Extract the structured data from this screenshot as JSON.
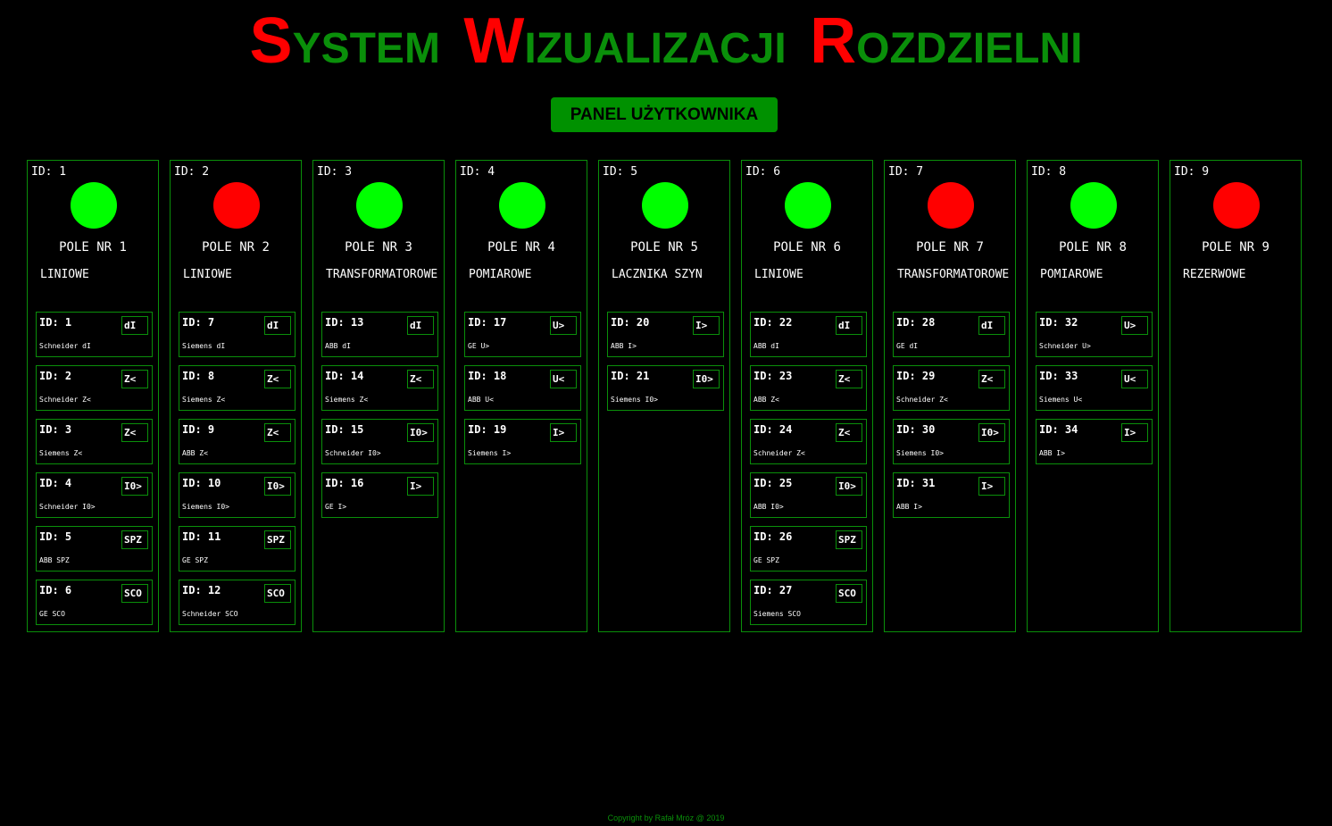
{
  "title": {
    "words": [
      {
        "cap": "S",
        "rest": "YSTEM"
      },
      {
        "cap": "W",
        "rest": "IZUALIZACJI"
      },
      {
        "cap": "R",
        "rest": "OZDZIELNI"
      }
    ]
  },
  "panel_button": "PANEL UŻYTKOWNIKA",
  "colors": {
    "on": "#00ff00",
    "off": "#ff0000",
    "border": "#0a8f0a",
    "button": "#009100"
  },
  "columns": [
    {
      "id_label": "ID: 1",
      "status": "on",
      "name": "POLE NR 1",
      "type": "LINIOWE",
      "devices": [
        {
          "id_label": "ID: 1",
          "code": "dI",
          "desc": "Schneider dI"
        },
        {
          "id_label": "ID: 2",
          "code": "Z<",
          "desc": "Schneider Z<"
        },
        {
          "id_label": "ID: 3",
          "code": "Z<",
          "desc": "Siemens Z<"
        },
        {
          "id_label": "ID: 4",
          "code": "I0>",
          "desc": "Schneider I0>"
        },
        {
          "id_label": "ID: 5",
          "code": "SPZ",
          "desc": "ABB SPZ"
        },
        {
          "id_label": "ID: 6",
          "code": "SCO",
          "desc": "GE SCO"
        }
      ]
    },
    {
      "id_label": "ID: 2",
      "status": "off",
      "name": "POLE NR 2",
      "type": "LINIOWE",
      "devices": [
        {
          "id_label": "ID: 7",
          "code": "dI",
          "desc": "Siemens dI"
        },
        {
          "id_label": "ID: 8",
          "code": "Z<",
          "desc": "Siemens Z<"
        },
        {
          "id_label": "ID: 9",
          "code": "Z<",
          "desc": "ABB Z<"
        },
        {
          "id_label": "ID: 10",
          "code": "I0>",
          "desc": "Siemens I0>"
        },
        {
          "id_label": "ID: 11",
          "code": "SPZ",
          "desc": "GE SPZ"
        },
        {
          "id_label": "ID: 12",
          "code": "SCO",
          "desc": "Schneider SCO"
        }
      ]
    },
    {
      "id_label": "ID: 3",
      "status": "on",
      "name": "POLE NR 3",
      "type": "TRANSFORMATOROWE",
      "devices": [
        {
          "id_label": "ID: 13",
          "code": "dI",
          "desc": "ABB dI"
        },
        {
          "id_label": "ID: 14",
          "code": "Z<",
          "desc": "Siemens Z<"
        },
        {
          "id_label": "ID: 15",
          "code": "I0>",
          "desc": "Schneider I0>"
        },
        {
          "id_label": "ID: 16",
          "code": "I>",
          "desc": "GE I>"
        }
      ]
    },
    {
      "id_label": "ID: 4",
      "status": "on",
      "name": "POLE NR 4",
      "type": "POMIAROWE",
      "devices": [
        {
          "id_label": "ID: 17",
          "code": "U>",
          "desc": "GE U>"
        },
        {
          "id_label": "ID: 18",
          "code": "U<",
          "desc": "ABB U<"
        },
        {
          "id_label": "ID: 19",
          "code": "I>",
          "desc": "Siemens I>"
        }
      ]
    },
    {
      "id_label": "ID: 5",
      "status": "on",
      "name": "POLE NR 5",
      "type": "LACZNIKA SZYN",
      "devices": [
        {
          "id_label": "ID: 20",
          "code": "I>",
          "desc": "ABB I>"
        },
        {
          "id_label": "ID: 21",
          "code": "I0>",
          "desc": "Siemens I0>"
        }
      ]
    },
    {
      "id_label": "ID: 6",
      "status": "on",
      "name": "POLE NR 6",
      "type": "LINIOWE",
      "devices": [
        {
          "id_label": "ID: 22",
          "code": "dI",
          "desc": "ABB dI"
        },
        {
          "id_label": "ID: 23",
          "code": "Z<",
          "desc": "ABB Z<"
        },
        {
          "id_label": "ID: 24",
          "code": "Z<",
          "desc": "Schneider Z<"
        },
        {
          "id_label": "ID: 25",
          "code": "I0>",
          "desc": "ABB I0>"
        },
        {
          "id_label": "ID: 26",
          "code": "SPZ",
          "desc": "GE SPZ"
        },
        {
          "id_label": "ID: 27",
          "code": "SCO",
          "desc": "Siemens SCO"
        }
      ]
    },
    {
      "id_label": "ID: 7",
      "status": "off",
      "name": "POLE NR 7",
      "type": "TRANSFORMATOROWE",
      "devices": [
        {
          "id_label": "ID: 28",
          "code": "dI",
          "desc": "GE dI"
        },
        {
          "id_label": "ID: 29",
          "code": "Z<",
          "desc": "Schneider Z<"
        },
        {
          "id_label": "ID: 30",
          "code": "I0>",
          "desc": "Siemens I0>"
        },
        {
          "id_label": "ID: 31",
          "code": "I>",
          "desc": "ABB I>"
        }
      ]
    },
    {
      "id_label": "ID: 8",
      "status": "on",
      "name": "POLE NR 8",
      "type": "POMIAROWE",
      "devices": [
        {
          "id_label": "ID: 32",
          "code": "U>",
          "desc": "Schneider U>"
        },
        {
          "id_label": "ID: 33",
          "code": "U<",
          "desc": "Siemens U<"
        },
        {
          "id_label": "ID: 34",
          "code": "I>",
          "desc": "ABB I>"
        }
      ]
    },
    {
      "id_label": "ID: 9",
      "status": "off",
      "name": "POLE NR 9",
      "type": "REZERWOWE",
      "devices": []
    }
  ],
  "footer": "Copyright by Rafał Mróz @ 2019"
}
